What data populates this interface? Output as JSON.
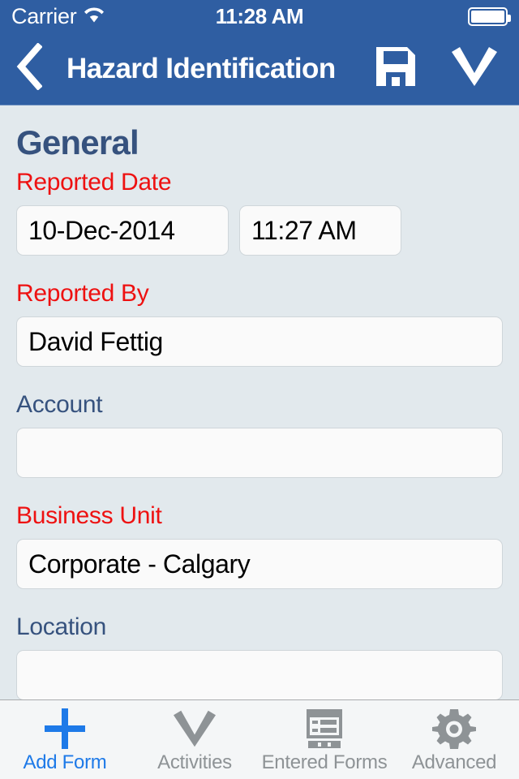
{
  "status_bar": {
    "carrier": "Carrier",
    "wifi_icon": "wifi-icon",
    "time": "11:28 AM",
    "battery_icon": "battery-full-icon",
    "battery_level": 100
  },
  "navbar": {
    "back_icon": "chevron-left-icon",
    "title": "Hazard Identification",
    "save_icon": "floppy-disk-save-icon",
    "confirm_icon": "checkmark-icon",
    "background_color": "#2f5ea2",
    "text_color": "#ffffff"
  },
  "form": {
    "section_title": "General",
    "colors": {
      "required_label": "#ee1111",
      "optional_label": "#36527e",
      "page_background": "#e2e9ed",
      "input_background": "#fafafa",
      "input_border": "#cfd6da"
    },
    "fields": [
      {
        "label": "Reported Date",
        "required": true,
        "type": "date-time",
        "date_value": "10-Dec-2014",
        "time_value": "11:27 AM"
      },
      {
        "label": "Reported By",
        "required": true,
        "type": "text",
        "value": "David Fettig"
      },
      {
        "label": "Account",
        "required": false,
        "type": "text",
        "value": ""
      },
      {
        "label": "Business Unit",
        "required": true,
        "type": "text",
        "value": "Corporate - Calgary"
      },
      {
        "label": "Location",
        "required": false,
        "type": "text",
        "value": ""
      }
    ]
  },
  "tabbar": {
    "active_color": "#1e7ae8",
    "inactive_color": "#8e9396",
    "items": [
      {
        "label": "Add Form",
        "icon": "plus-icon",
        "active": true
      },
      {
        "label": "Activities",
        "icon": "checkmark-icon",
        "active": false
      },
      {
        "label": "Entered Forms",
        "icon": "form-list-icon",
        "active": false
      },
      {
        "label": "Advanced",
        "icon": "gear-icon",
        "active": false
      }
    ]
  }
}
